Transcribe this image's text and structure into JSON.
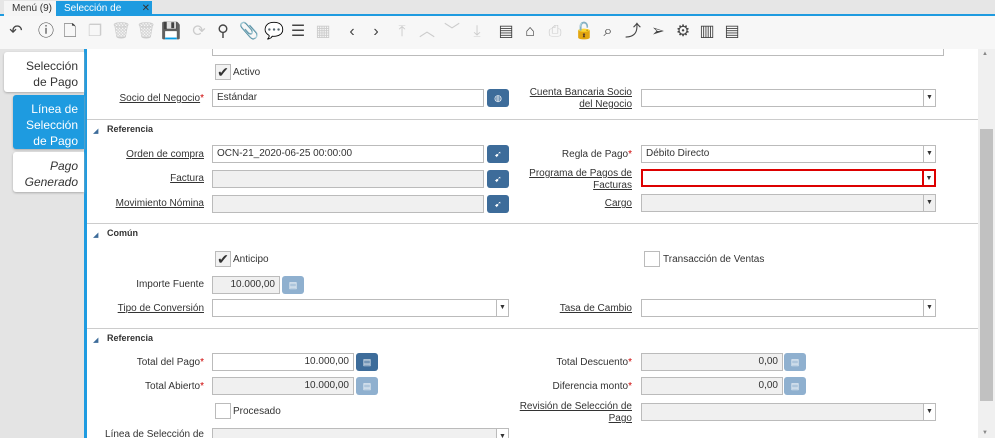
{
  "tabs": [
    {
      "label": "Menú (9)"
    },
    {
      "label": "Selección de Pago"
    }
  ],
  "toolbar_icons": [
    "undo-icon",
    "help-icon",
    "new-icon",
    "copy-icon",
    "delete-icon",
    "delete-selection-icon",
    "save-icon",
    "refresh-icon",
    "find-icon",
    "attachment-icon",
    "chat-icon",
    "grid-toggle-icon",
    "calendar-icon",
    "previous-icon",
    "next-icon",
    "first-icon",
    "parent-icon",
    "detail-icon",
    "last-icon",
    "report-icon",
    "archive-icon",
    "print-icon",
    "lock-icon",
    "zoom-across-icon",
    "workflow-icon",
    "send-icon",
    "settings-icon",
    "product-info-icon",
    "post-icon"
  ],
  "side_tabs": [
    {
      "label": "Selección de Pago"
    },
    {
      "label": "Línea de Selección de Pago"
    },
    {
      "label": "Pago Generado"
    }
  ],
  "form": {
    "activo": "Activo",
    "socio_label": "Socio del Negocio",
    "socio_value": "Estándar",
    "cuenta_label": "Cuenta Bancaria Socio del Negocio",
    "sec_referencia": "Referencia",
    "orden_label": "Orden de compra",
    "orden_value": "OCN-21_2020-06-25 00:00:00",
    "factura_label": "Factura",
    "movimiento_label": "Movimiento Nómina",
    "regla_label": "Regla de Pago",
    "regla_value": "Débito Directo",
    "programa_label": "Programa de Pagos de Facturas",
    "cargo_label": "Cargo",
    "sec_comun": "Común",
    "anticipo": "Anticipo",
    "transaccion": "Transacción de Ventas",
    "importe_label": "Importe Fuente",
    "importe_value": "10.000,00",
    "tipo_label": "Tipo de Conversión",
    "tasa_label": "Tasa de Cambio",
    "sec_referencia2": "Referencia",
    "total_pago_label": "Total del Pago",
    "total_pago_value": "10.000,00",
    "total_abierto_label": "Total Abierto",
    "total_abierto_value": "10.000,00",
    "total_desc_label": "Total Descuento",
    "total_desc_value": "0,00",
    "dif_label": "Diferencia monto",
    "dif_value": "0,00",
    "procesado": "Procesado",
    "revision_label": "Revisión de Selección de Pago",
    "linea_label": "Línea de Selección de Pago"
  }
}
